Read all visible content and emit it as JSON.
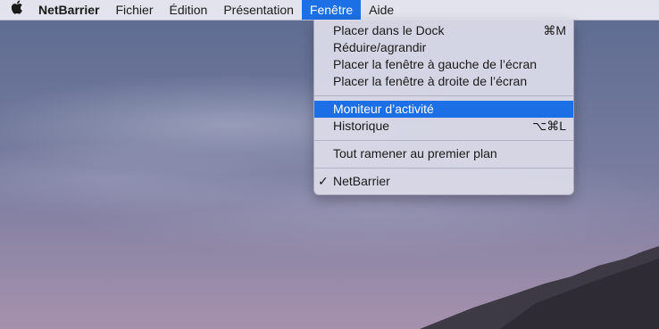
{
  "menubar": {
    "apple_icon": "apple-logo-icon",
    "app_name": "NetBarrier",
    "items": [
      "Fichier",
      "Édition",
      "Présentation",
      "Fenêtre",
      "Aide"
    ]
  },
  "window_menu": {
    "items": [
      {
        "label": "Placer dans le Dock",
        "shortcut": "⌘M"
      },
      {
        "label": "Réduire/agrandir",
        "shortcut": ""
      },
      {
        "label": "Placer la fenêtre à gauche de l’écran",
        "shortcut": ""
      },
      {
        "label": "Placer la fenêtre à droite de l’écran",
        "shortcut": ""
      },
      {
        "label": "Moniteur d’activité",
        "shortcut": ""
      },
      {
        "label": "Historique",
        "shortcut": "⌥⌘L"
      },
      {
        "label": "Tout ramener au premier plan",
        "shortcut": ""
      },
      {
        "label": "NetBarrier",
        "shortcut": "",
        "check": "✓"
      }
    ]
  },
  "colors": {
    "menubar_bg": "#eeeef4",
    "highlight": "#1d6fe5"
  }
}
